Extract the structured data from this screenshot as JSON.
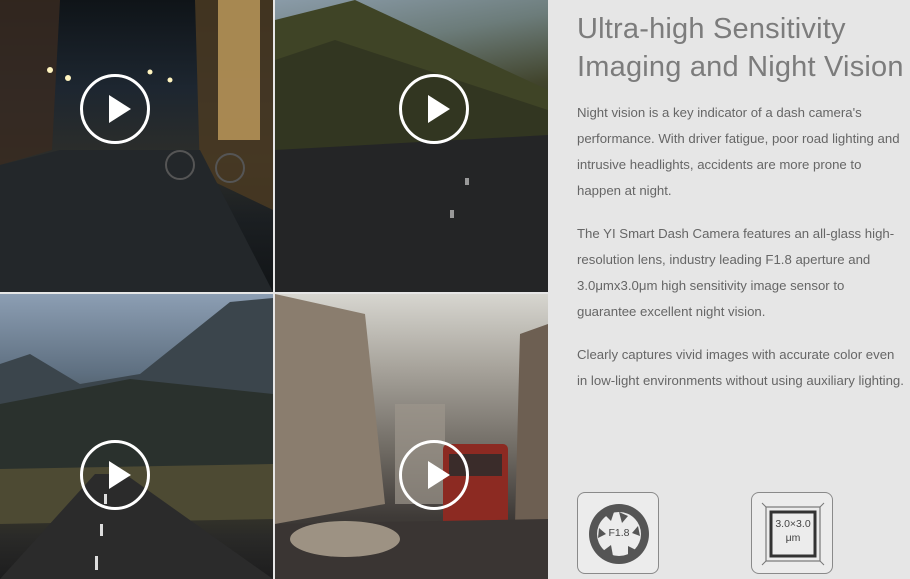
{
  "heading": "Ultra-high Sensitivity Imaging and Night Vision",
  "paragraphs": [
    "Night vision is a key indicator of a dash camera's performance. With driver fatigue, poor road lighting and intrusive headlights, accidents are more prone to happen at night.",
    "The YI Smart Dash Camera features an all-glass high-resolution lens, industry leading F1.8 aperture and 3.0μmx3.0μm high sensitivity image sensor to guarantee excellent night vision.",
    "Clearly captures vivid images with accurate color even in low-light environments without using auxiliary lighting."
  ],
  "videos": [
    {
      "scene": "night-street",
      "icon": "play-icon"
    },
    {
      "scene": "hillside-road",
      "icon": "play-icon"
    },
    {
      "scene": "mountain-road",
      "icon": "play-icon"
    },
    {
      "scene": "city-street-bus",
      "icon": "play-icon"
    }
  ],
  "spec_icons": [
    {
      "icon": "aperture-icon",
      "label": "F1.8"
    },
    {
      "icon": "sensor-icon",
      "label_line1": "3.0×3.0",
      "label_line2": "μm"
    }
  ],
  "colors": {
    "background": "#e6e6e6",
    "heading": "#7c7c7c",
    "body_text": "#666666",
    "play_ring": "#ffffff"
  }
}
